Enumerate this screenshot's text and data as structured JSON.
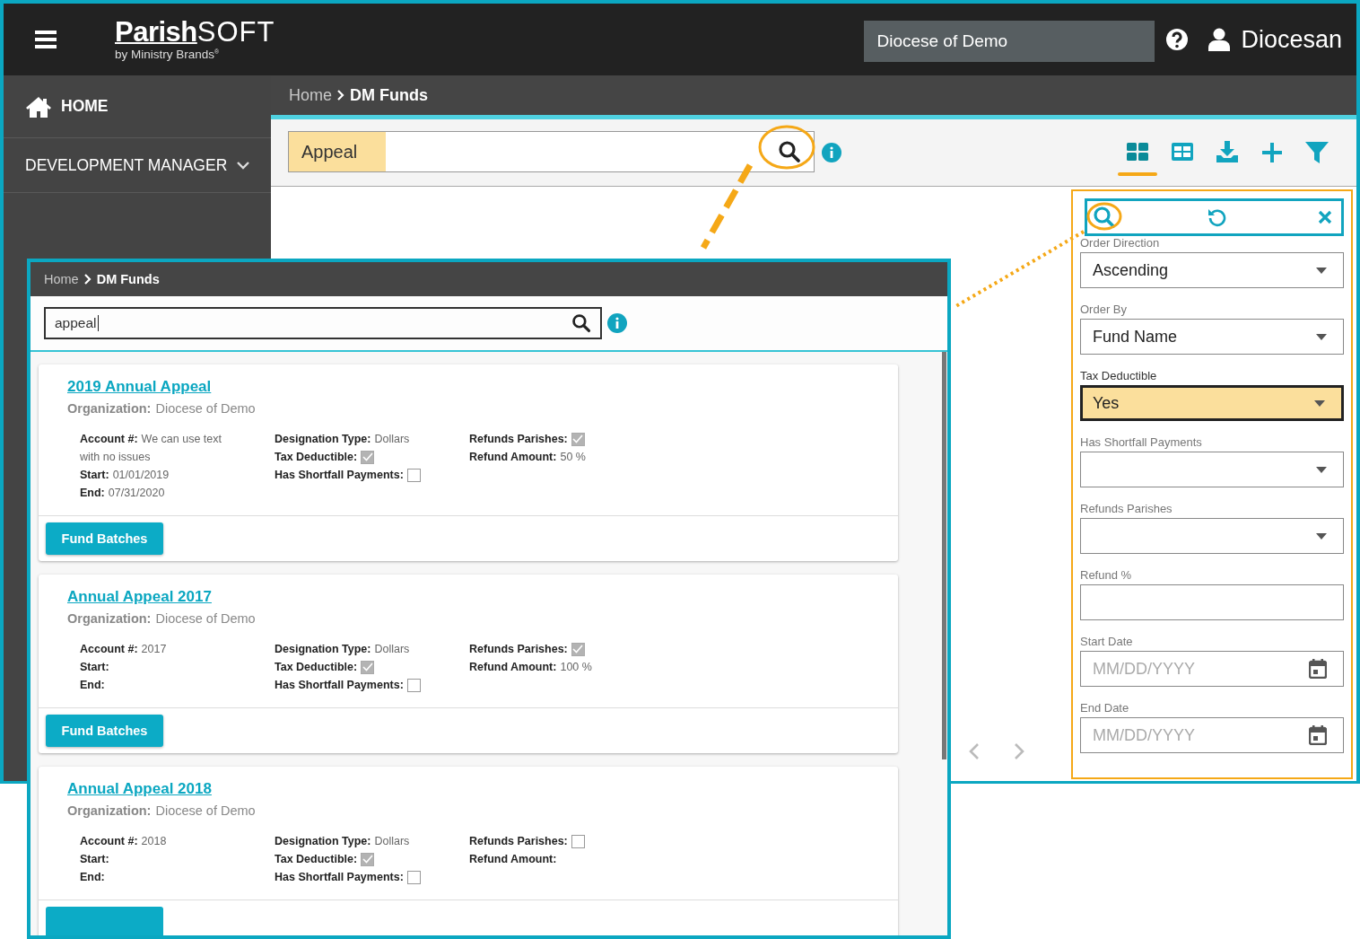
{
  "header": {
    "logo": "Parish",
    "logo_suffix": "SOFT",
    "tagline": "by Ministry Brands$^{®}$",
    "organization": "Diocese of Demo",
    "user": "Diocesan"
  },
  "sidebar": {
    "items": [
      {
        "kind": "home",
        "label": "HOME"
      },
      {
        "kind": "group",
        "label": "DEVELOPMENT MANAGER"
      }
    ]
  },
  "breadcrumb": {
    "parent": "Home",
    "current": "DM Funds"
  },
  "search": {
    "value": "Appeal",
    "highlighted": true
  },
  "toolbar": {
    "buttons": [
      {
        "kind": "cards",
        "selected": true
      },
      {
        "kind": "table",
        "selected": false
      },
      {
        "kind": "download",
        "selected": false
      },
      {
        "kind": "add",
        "selected": false
      },
      {
        "kind": "filter",
        "selected": false
      }
    ]
  },
  "filter_panel": {
    "fields": [
      {
        "kind": "select",
        "label": "Order Direction",
        "value": "Ascending",
        "highlighted": false,
        "label_dark": false
      },
      {
        "kind": "select",
        "label": "Order By",
        "value": "Fund Name",
        "highlighted": false,
        "label_dark": false
      },
      {
        "kind": "select",
        "label": "Tax Deductible",
        "value": "Yes",
        "highlighted": true,
        "label_dark": true
      },
      {
        "kind": "select",
        "label": "Has Shortfall Payments",
        "highlighted": false,
        "label_dark": false
      },
      {
        "kind": "select",
        "label": "Refunds Parishes",
        "highlighted": false,
        "label_dark": false
      },
      {
        "kind": "text",
        "label": "Refund %",
        "highlighted": false,
        "label_dark": false
      },
      {
        "kind": "date",
        "label": "Start Date",
        "placeholder": "MM/DD/YYYY",
        "highlighted": false,
        "label_dark": false
      },
      {
        "kind": "date",
        "label": "End Date",
        "placeholder": "MM/DD/YYYY",
        "highlighted": false,
        "label_dark": false
      }
    ]
  },
  "inset": {
    "breadcrumb": {
      "parent": "Home",
      "current": "DM Funds"
    },
    "search": {
      "value": "appeal"
    },
    "cards": [
      {
        "title": "2019 Annual Appeal",
        "org_label": "Organization:",
        "org": "Diocese of Demo",
        "columns": [
          [
            {
              "kind": "text",
              "label": "Account #:",
              "value": "We can use text with no issues"
            },
            {
              "kind": "text",
              "label": "Start:",
              "value": "01/01/2019"
            },
            {
              "kind": "text",
              "label": "End:",
              "value": "07/31/2020"
            }
          ],
          [
            {
              "kind": "text",
              "label": "Designation Type:",
              "value": "Dollars"
            },
            {
              "kind": "checkbox",
              "label": "Tax Deductible:",
              "checked": true
            },
            {
              "kind": "checkbox",
              "label": "Has Shortfall Payments:",
              "checked": false
            }
          ],
          [
            {
              "kind": "checkbox",
              "label": "Refunds Parishes:",
              "checked": true
            },
            {
              "kind": "text",
              "label": "Refund Amount:",
              "value": "50 %"
            }
          ]
        ],
        "button": "Fund Batches"
      },
      {
        "title": "Annual Appeal 2017",
        "org_label": "Organization:",
        "org": "Diocese of Demo",
        "columns": [
          [
            {
              "kind": "text",
              "label": "Account #:",
              "value": "2017"
            },
            {
              "kind": "text",
              "label": "Start:"
            },
            {
              "kind": "text",
              "label": "End:"
            }
          ],
          [
            {
              "kind": "text",
              "label": "Designation Type:",
              "value": "Dollars"
            },
            {
              "kind": "checkbox",
              "label": "Tax Deductible:",
              "checked": true
            },
            {
              "kind": "checkbox",
              "label": "Has Shortfall Payments:",
              "checked": false
            }
          ],
          [
            {
              "kind": "checkbox",
              "label": "Refunds Parishes:",
              "checked": true
            },
            {
              "kind": "text",
              "label": "Refund Amount:",
              "value": "100 %"
            }
          ]
        ],
        "button": "Fund Batches"
      },
      {
        "title": "Annual Appeal 2018",
        "org_label": "Organization:",
        "org": "Diocese of Demo",
        "columns": [
          [
            {
              "kind": "text",
              "label": "Account #:",
              "value": "2018"
            },
            {
              "kind": "text",
              "label": "Start:"
            },
            {
              "kind": "text",
              "label": "End:"
            }
          ],
          [
            {
              "kind": "text",
              "label": "Designation Type:",
              "value": "Dollars"
            },
            {
              "kind": "checkbox",
              "label": "Tax Deductible:",
              "checked": true
            },
            {
              "kind": "checkbox",
              "label": "Has Shortfall Payments:",
              "checked": false
            }
          ],
          [
            {
              "kind": "checkbox",
              "label": "Refunds Parishes:",
              "checked": false
            },
            {
              "kind": "text",
              "label": "Refund Amount:"
            }
          ]
        ],
        "button_cut": true
      }
    ]
  }
}
